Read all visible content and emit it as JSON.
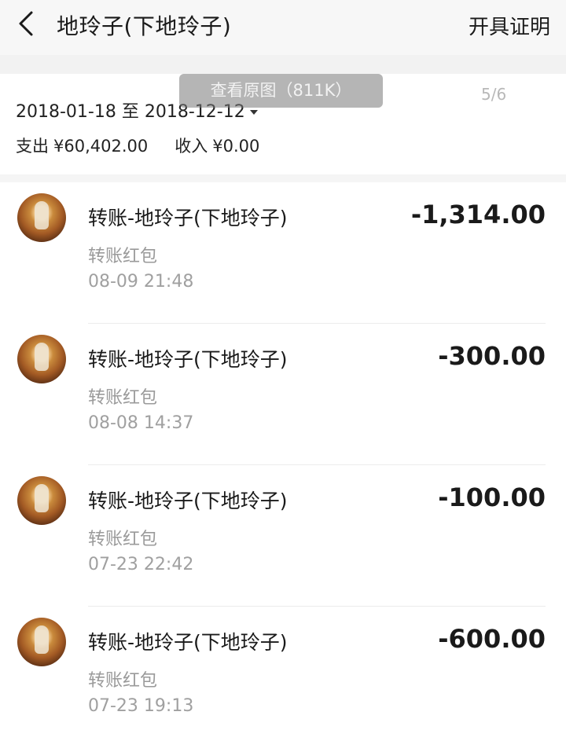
{
  "header": {
    "title": "地玲子(下地玲子)",
    "action_label": "开具证明"
  },
  "overlay": {
    "view_original": "查看原图（811K）",
    "page_indicator": "5/6"
  },
  "summary": {
    "date_range": "2018-01-18 至 2018-12-12",
    "expense_label": "支出",
    "expense_value": "¥60,402.00",
    "income_label": "收入",
    "income_value": "¥0.00"
  },
  "transactions": [
    {
      "title": "转账-地玲子(下地玲子)",
      "type": "转账红包",
      "time": "08-09  21:48",
      "amount": "-1,314.00"
    },
    {
      "title": "转账-地玲子(下地玲子)",
      "type": "转账红包",
      "time": "08-08  14:37",
      "amount": "-300.00"
    },
    {
      "title": "转账-地玲子(下地玲子)",
      "type": "转账红包",
      "time": "07-23  22:42",
      "amount": "-100.00"
    },
    {
      "title": "转账-地玲子(下地玲子)",
      "type": "转账红包",
      "time": "07-23  19:13",
      "amount": "-600.00"
    }
  ],
  "colors": {
    "header_bg": "#f7f7f7",
    "text_primary": "#1a1a1a",
    "text_secondary": "#9a9a9a"
  },
  "icons": {
    "back": "back-chevron-icon",
    "date_caret": "caret-down-icon",
    "avatar": "dog-avatar-image"
  }
}
